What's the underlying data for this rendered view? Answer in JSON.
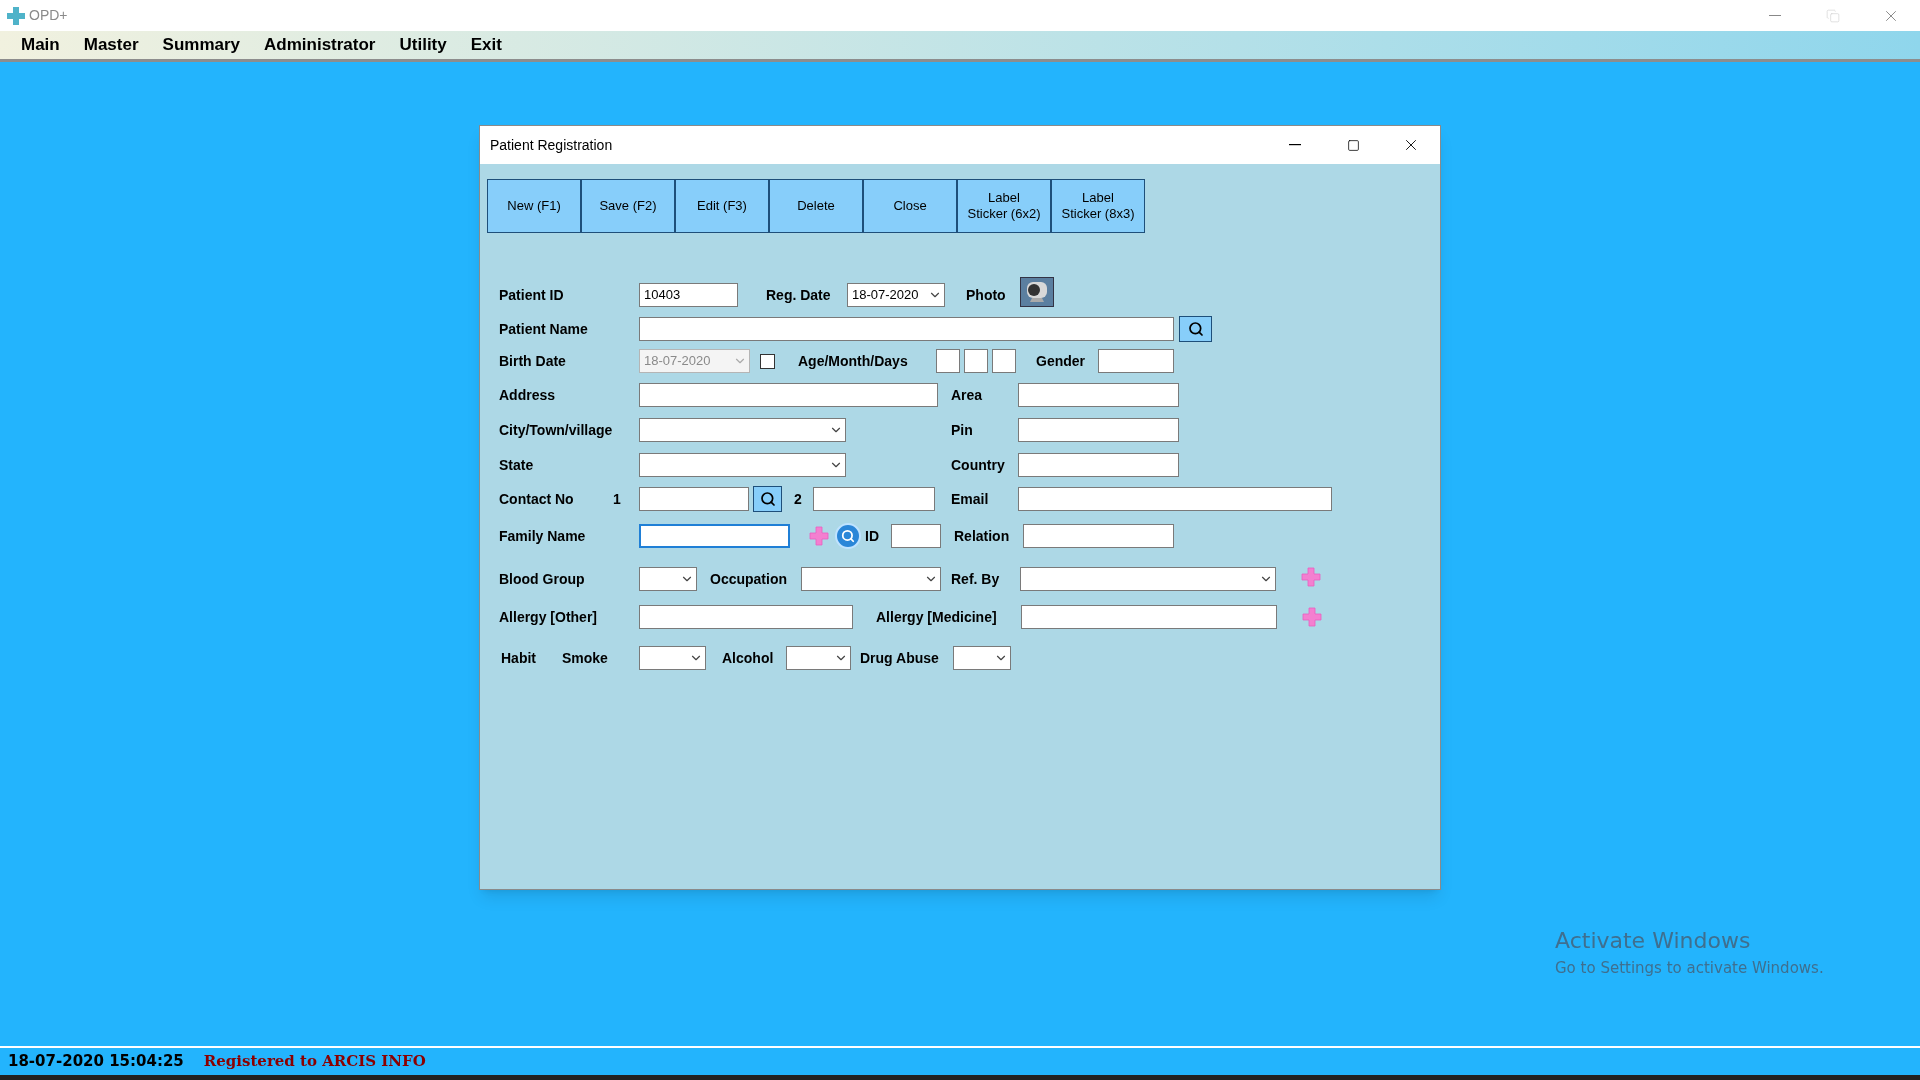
{
  "app": {
    "title": "OPD+"
  },
  "menu": [
    {
      "label": "Main"
    },
    {
      "label": "Master"
    },
    {
      "label": "Summary"
    },
    {
      "label": "Administrator"
    },
    {
      "label": "Utility"
    },
    {
      "label": "Exit"
    }
  ],
  "dialog": {
    "title": "Patient Registration",
    "toolbar": [
      {
        "label": "New (F1)"
      },
      {
        "label": "Save (F2)"
      },
      {
        "label": "Edit (F3)"
      },
      {
        "label": "Delete"
      },
      {
        "label": "Close"
      },
      {
        "label": "Label\nSticker (6x2)"
      },
      {
        "label": "Label\nSticker (8x3)"
      }
    ],
    "patient_id": {
      "label": "Patient ID",
      "value": "10403"
    },
    "reg_date": {
      "label": "Reg. Date",
      "value": "18-07-2020"
    },
    "photo": {
      "label": "Photo"
    },
    "patient_name": {
      "label": "Patient Name"
    },
    "birth_date": {
      "label": "Birth Date",
      "value": "18-07-2020",
      "disabled": true
    },
    "age_checkbox": {
      "checked": false
    },
    "age": {
      "label": "Age/Month/Days"
    },
    "gender": {
      "label": "Gender"
    },
    "address": {
      "label": "Address"
    },
    "area": {
      "label": "Area"
    },
    "city": {
      "label": "City/Town/village"
    },
    "pin": {
      "label": "Pin"
    },
    "state": {
      "label": "State"
    },
    "country": {
      "label": "Country"
    },
    "contact": {
      "label": "Contact No",
      "first": "1",
      "second": "2"
    },
    "email": {
      "label": "Email"
    },
    "family_name": {
      "label": "Family Name",
      "focused": true
    },
    "family_id": {
      "label": "ID"
    },
    "relation": {
      "label": "Relation"
    },
    "blood_group": {
      "label": "Blood Group"
    },
    "occupation": {
      "label": "Occupation"
    },
    "ref_by": {
      "label": "Ref. By"
    },
    "allergy_other": {
      "label": "Allergy [Other]"
    },
    "allergy_medicine": {
      "label": "Allergy [Medicine]"
    },
    "habit": {
      "label": "Habit"
    },
    "smoke": {
      "label": "Smoke"
    },
    "alcohol": {
      "label": "Alcohol"
    },
    "drug_abuse": {
      "label": "Drug Abuse"
    }
  },
  "status_bar": {
    "datetime": "18-07-2020 15:04:25",
    "registration": "Registered to ARCIS INFO"
  },
  "activation_notice": {
    "title": "Activate Windows",
    "subtitle": "Go to Settings to activate Windows."
  }
}
